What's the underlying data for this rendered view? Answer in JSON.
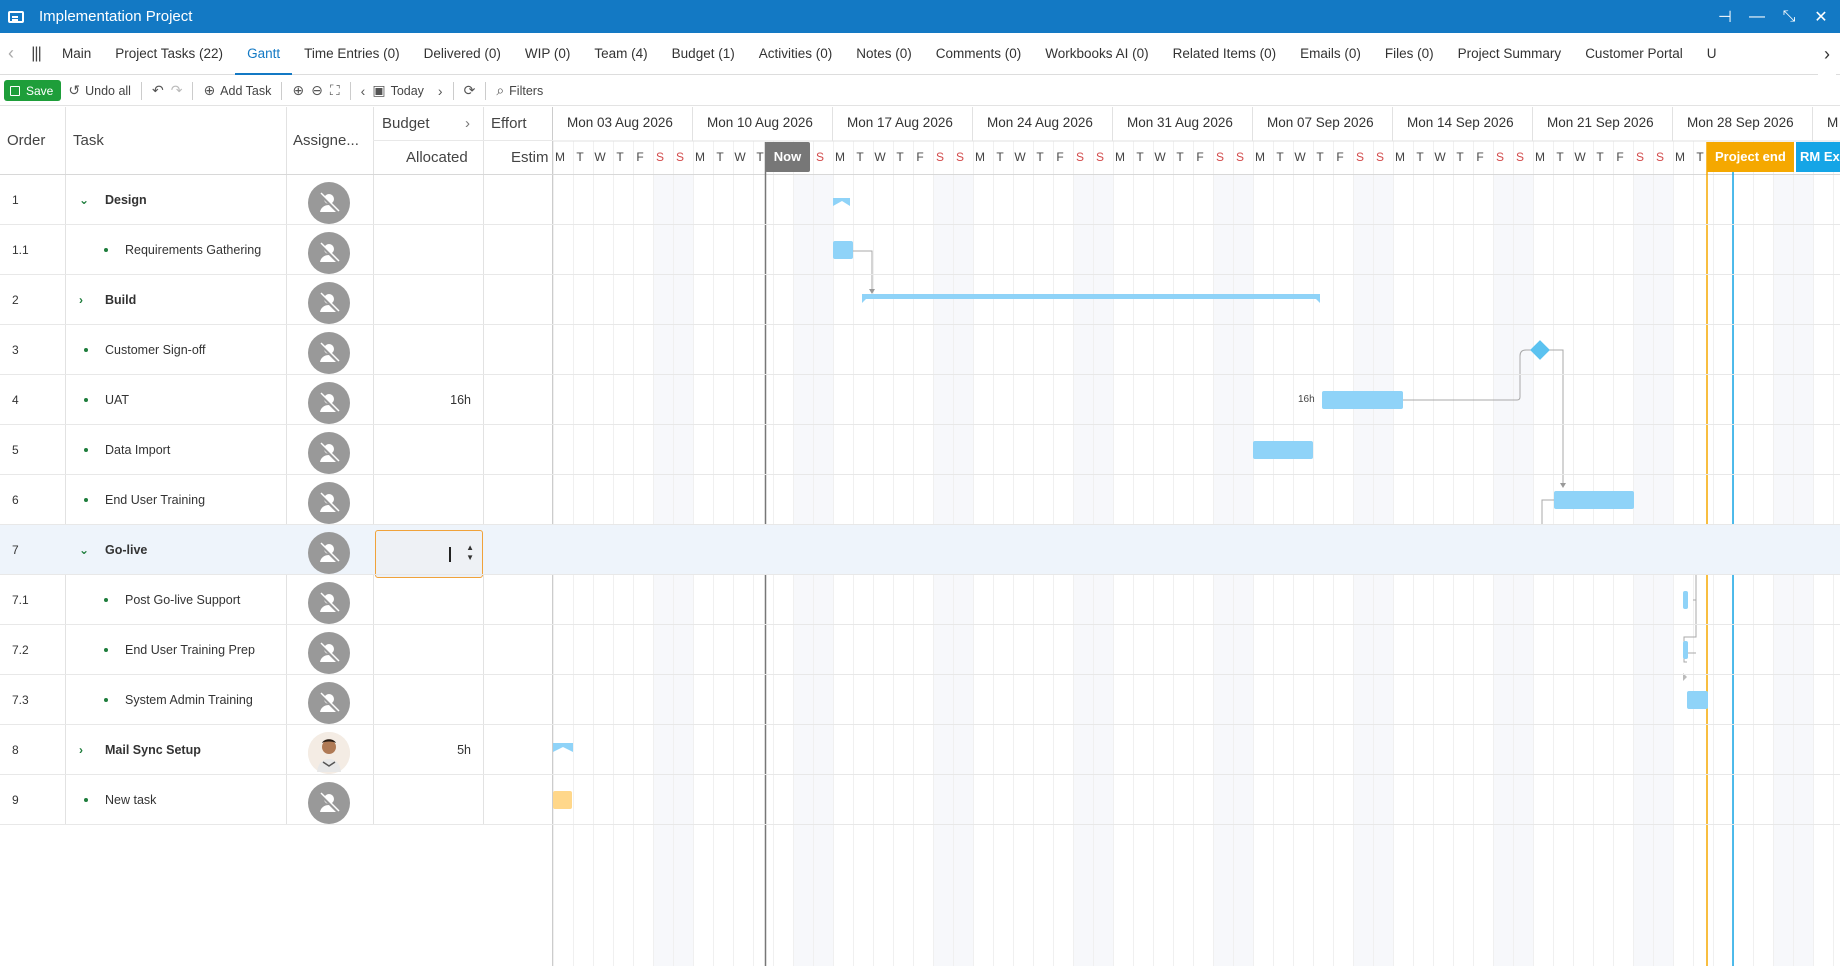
{
  "window": {
    "title": "Implementation Project",
    "buttons": [
      "pin-icon",
      "minimize-icon",
      "restore-icon",
      "close-icon"
    ]
  },
  "tabs": [
    {
      "label": "Main"
    },
    {
      "label": "Project Tasks (22)"
    },
    {
      "label": "Gantt",
      "active": true
    },
    {
      "label": "Time Entries (0)"
    },
    {
      "label": "Delivered (0)"
    },
    {
      "label": "WIP (0)"
    },
    {
      "label": "Team (4)"
    },
    {
      "label": "Budget (1)"
    },
    {
      "label": "Activities (0)"
    },
    {
      "label": "Notes (0)"
    },
    {
      "label": "Comments (0)"
    },
    {
      "label": "Workbooks AI (0)"
    },
    {
      "label": "Related Items (0)"
    },
    {
      "label": "Emails (0)"
    },
    {
      "label": "Files (0)"
    },
    {
      "label": "Project Summary"
    },
    {
      "label": "Customer Portal"
    },
    {
      "label": "U"
    }
  ],
  "toolbar": {
    "save": "Save",
    "undo_all": "Undo all",
    "add_task": "Add Task",
    "today": "Today",
    "filters": "Filters"
  },
  "columns": {
    "order": "Order",
    "task": "Task",
    "assignee": "Assigne...",
    "budget": "Budget",
    "allocated": "Allocated",
    "effort": "Effort",
    "estimate": "Estim"
  },
  "rows": [
    {
      "order": "1",
      "task": "Design",
      "level": 0,
      "parent": true,
      "expanded": true,
      "allocated": "",
      "avatar": "none"
    },
    {
      "order": "1.1",
      "task": "Requirements Gathering",
      "level": 1,
      "parent": false,
      "allocated": "",
      "avatar": "none"
    },
    {
      "order": "2",
      "task": "Build",
      "level": 0,
      "parent": true,
      "expanded": false,
      "allocated": "",
      "avatar": "none"
    },
    {
      "order": "3",
      "task": "Customer Sign-off",
      "level": 0,
      "parent": false,
      "allocated": "",
      "avatar": "none"
    },
    {
      "order": "4",
      "task": "UAT",
      "level": 0,
      "parent": false,
      "allocated": "16h",
      "avatar": "none"
    },
    {
      "order": "5",
      "task": "Data Import",
      "level": 0,
      "parent": false,
      "allocated": "",
      "avatar": "none"
    },
    {
      "order": "6",
      "task": "End User Training",
      "level": 0,
      "parent": false,
      "allocated": "",
      "avatar": "none"
    },
    {
      "order": "7",
      "task": "Go-live",
      "level": 0,
      "parent": true,
      "expanded": true,
      "allocated": "",
      "avatar": "none",
      "editing": true
    },
    {
      "order": "7.1",
      "task": "Post Go-live Support",
      "level": 1,
      "parent": false,
      "allocated": "",
      "avatar": "none"
    },
    {
      "order": "7.2",
      "task": "End User Training Prep",
      "level": 1,
      "parent": false,
      "allocated": "",
      "avatar": "none"
    },
    {
      "order": "7.3",
      "task": "System Admin Training",
      "level": 1,
      "parent": false,
      "allocated": "",
      "avatar": "none"
    },
    {
      "order": "8",
      "task": "Mail Sync Setup",
      "level": 0,
      "parent": true,
      "expanded": false,
      "allocated": "5h",
      "avatar": "photo"
    },
    {
      "order": "9",
      "task": "New task",
      "level": 0,
      "parent": false,
      "allocated": "",
      "avatar": "none"
    }
  ],
  "timeline": {
    "weeks": [
      "Mon 03 Aug 2026",
      "Mon 10 Aug 2026",
      "Mon 17 Aug 2026",
      "Mon 24 Aug 2026",
      "Mon 31 Aug 2026",
      "Mon 07 Sep 2026",
      "Mon 14 Sep 2026",
      "Mon 21 Sep 2026",
      "Mon 28 Sep 2026",
      "M"
    ],
    "day_letters": [
      "M",
      "T",
      "W",
      "T",
      "F",
      "S",
      "S"
    ],
    "now_label": "Now",
    "project_end_label": "Project end",
    "rm_label": "RM Ex",
    "uat_bar_label": "16h"
  },
  "colors": {
    "accent": "#1379c4",
    "save": "#1e9e3a",
    "bar": "#8fd3f8",
    "milestone": "#5bc2f0",
    "project_end": "#f5a800",
    "rm": "#15a5e6",
    "new_task": "#ffd78a"
  }
}
